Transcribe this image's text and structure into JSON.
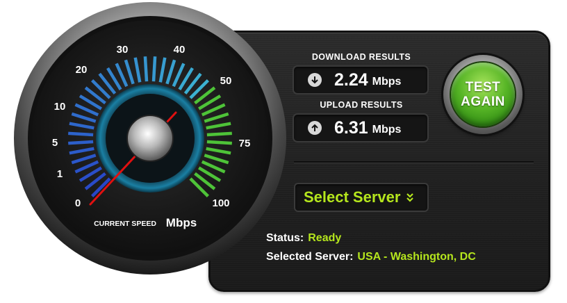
{
  "gauge": {
    "scale_labels": [
      "0",
      "1",
      "5",
      "10",
      "20",
      "30",
      "40",
      "50",
      "75",
      "100"
    ],
    "caption": "CURRENT SPEED",
    "unit": "Mbps",
    "needle_value": 0
  },
  "results": {
    "download": {
      "label": "DOWNLOAD RESULTS",
      "value": "2.24",
      "unit": "Mbps",
      "icon": "arrow-down-circle-icon"
    },
    "upload": {
      "label": "UPLOAD RESULTS",
      "value": "6.31",
      "unit": "Mbps",
      "icon": "arrow-up-circle-icon"
    }
  },
  "test_button": {
    "line1": "TEST",
    "line2": "AGAIN"
  },
  "select_server": {
    "label": "Select Server",
    "icon": "double-chevron-down-icon"
  },
  "status": {
    "label": "Status:",
    "value": "Ready"
  },
  "selected_server": {
    "label": "Selected Server:",
    "value": "USA - Washington, DC"
  },
  "colors": {
    "accent": "#b5e61d",
    "green": "#57b526",
    "blue": "#3a62d8",
    "needle": "#e01010"
  }
}
